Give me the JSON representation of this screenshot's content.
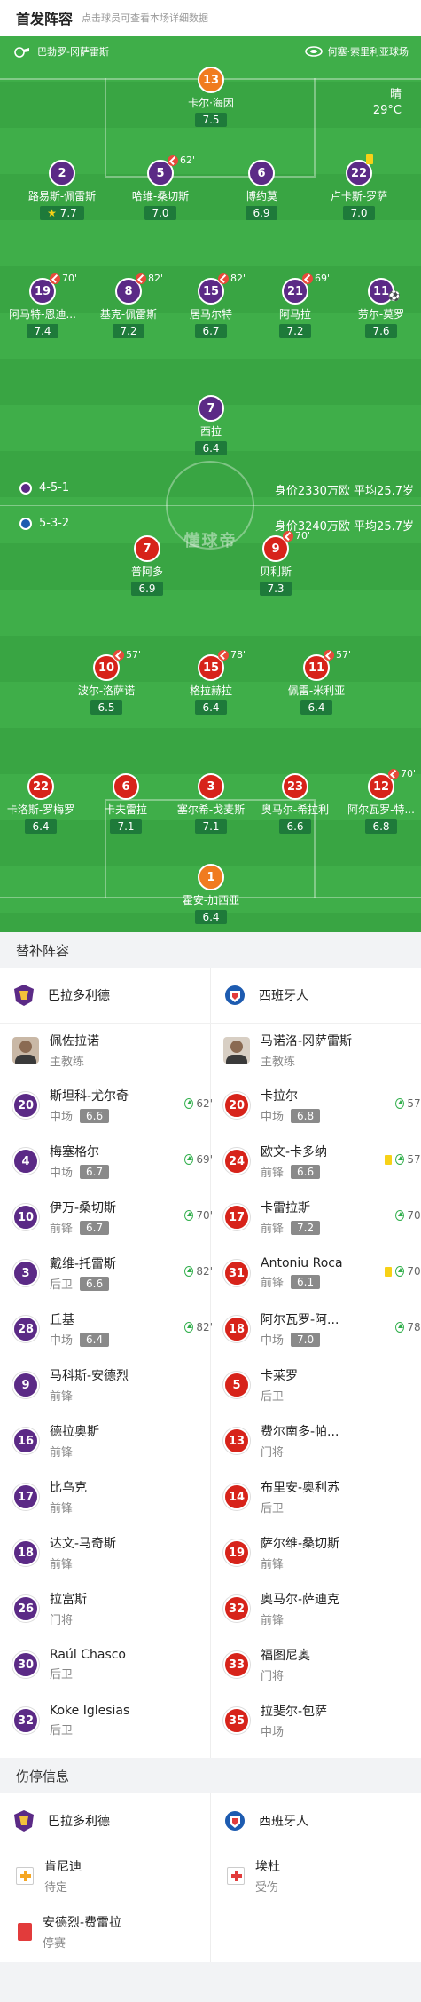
{
  "header": {
    "title": "首发阵容",
    "subtitle": "点击球员可查看本场详细数据"
  },
  "match": {
    "home_coach": "巴勃罗-冈萨雷斯",
    "venue": "何塞·索里利亚球场",
    "weather_label": "晴",
    "temperature": "29°C",
    "home_formation": "4-5-1",
    "away_formation": "5-3-2",
    "home_value": "身价2330万欧 平均25.7岁",
    "away_value": "身价3240万欧 平均25.7岁",
    "watermark": "懂球帝"
  },
  "colors": {
    "home": "#5b2a86",
    "away": "#d7231a",
    "gk": "#f07b1f",
    "pitch": "#3fae49"
  },
  "home_players": [
    {
      "num": "13",
      "name": "卡尔·海因",
      "rating": "7.5",
      "gk": true
    },
    {
      "num": "2",
      "name": "路易斯-佩雷斯",
      "rating": "7.7",
      "star": true
    },
    {
      "num": "5",
      "name": "哈维-桑切斯",
      "rating": "7.0",
      "event": "62'"
    },
    {
      "num": "6",
      "name": "博约莫",
      "rating": "6.9"
    },
    {
      "num": "22",
      "name": "卢卡斯-罗萨",
      "rating": "7.0",
      "card": "yellow"
    },
    {
      "num": "19",
      "name": "阿马特-恩迪...",
      "rating": "7.4",
      "event": "70'"
    },
    {
      "num": "8",
      "name": "基克-佩雷斯",
      "rating": "7.2",
      "event": "82'"
    },
    {
      "num": "15",
      "name": "居马尔特",
      "rating": "6.7",
      "event": "82'"
    },
    {
      "num": "21",
      "name": "阿马拉",
      "rating": "7.2",
      "event": "69'"
    },
    {
      "num": "11",
      "name": "劳尔-莫罗",
      "rating": "7.6",
      "ball": true
    },
    {
      "num": "7",
      "name": "西拉",
      "rating": "6.4"
    }
  ],
  "away_players": [
    {
      "num": "7",
      "name": "普阿多",
      "rating": "6.9"
    },
    {
      "num": "9",
      "name": "贝利斯",
      "rating": "7.3",
      "event": "70'"
    },
    {
      "num": "10",
      "name": "波尔-洛萨诺",
      "rating": "6.5",
      "event": "57'"
    },
    {
      "num": "15",
      "name": "格拉赫拉",
      "rating": "6.4",
      "event": "78'"
    },
    {
      "num": "11",
      "name": "佩雷-米利亚",
      "rating": "6.4",
      "event": "57'"
    },
    {
      "num": "22",
      "name": "卡洛斯-罗梅罗",
      "rating": "6.4"
    },
    {
      "num": "6",
      "name": "卡夫雷拉",
      "rating": "7.1"
    },
    {
      "num": "3",
      "name": "塞尔希-戈麦斯",
      "rating": "7.1"
    },
    {
      "num": "23",
      "name": "奥马尔-希拉利",
      "rating": "6.6"
    },
    {
      "num": "12",
      "name": "阿尔瓦罗-特...",
      "rating": "6.8",
      "event": "70'"
    },
    {
      "num": "1",
      "name": "霍安-加西亚",
      "rating": "6.4",
      "gk": true
    }
  ],
  "subs_section": "替补阵容",
  "home_team": "巴拉多利德",
  "away_team": "西班牙人",
  "home_coach": {
    "name": "佩佐拉诺",
    "role": "主教练"
  },
  "away_coach": {
    "name": "马诺洛-冈萨雷斯",
    "role": "主教练"
  },
  "home_subs": [
    {
      "num": "20",
      "name": "斯坦科-尤尔奇",
      "pos": "中场",
      "rating": "6.6",
      "time": "62'"
    },
    {
      "num": "4",
      "name": "梅塞格尔",
      "pos": "中场",
      "rating": "6.7",
      "time": "69'"
    },
    {
      "num": "10",
      "name": "伊万-桑切斯",
      "pos": "前锋",
      "rating": "6.7",
      "time": "70'"
    },
    {
      "num": "3",
      "name": "戴维-托雷斯",
      "pos": "后卫",
      "rating": "6.6",
      "time": "82'"
    },
    {
      "num": "28",
      "name": "丘基",
      "pos": "中场",
      "rating": "6.4",
      "time": "82'"
    },
    {
      "num": "9",
      "name": "马科斯-安德烈",
      "pos": "前锋"
    },
    {
      "num": "16",
      "name": "德拉奥斯",
      "pos": "前锋"
    },
    {
      "num": "17",
      "name": "比乌克",
      "pos": "前锋"
    },
    {
      "num": "18",
      "name": "达文-马奇斯",
      "pos": "前锋"
    },
    {
      "num": "26",
      "name": "拉富斯",
      "pos": "门将"
    },
    {
      "num": "30",
      "name": "Raúl Chasco",
      "pos": "后卫"
    },
    {
      "num": "32",
      "name": "Koke Iglesias",
      "pos": "后卫"
    }
  ],
  "away_subs": [
    {
      "num": "20",
      "name": "卡拉尔",
      "pos": "中场",
      "rating": "6.8",
      "time": "57'"
    },
    {
      "num": "24",
      "name": "欧文-卡多纳",
      "pos": "前锋",
      "rating": "6.6",
      "time": "57'",
      "card": "yellow"
    },
    {
      "num": "17",
      "name": "卡雷拉斯",
      "pos": "前锋",
      "rating": "7.2",
      "time": "70'"
    },
    {
      "num": "31",
      "name": "Antoniu Roca",
      "pos": "前锋",
      "rating": "6.1",
      "time": "70'",
      "card": "yellow"
    },
    {
      "num": "18",
      "name": "阿尔瓦罗-阿...",
      "pos": "中场",
      "rating": "7.0",
      "time": "78'"
    },
    {
      "num": "5",
      "name": "卡莱罗",
      "pos": "后卫"
    },
    {
      "num": "13",
      "name": "费尔南多-帕...",
      "pos": "门将"
    },
    {
      "num": "14",
      "name": "布里安-奥利苏",
      "pos": "后卫"
    },
    {
      "num": "19",
      "name": "萨尔维-桑切斯",
      "pos": "前锋"
    },
    {
      "num": "32",
      "name": "奥马尔-萨迪克",
      "pos": "前锋"
    },
    {
      "num": "33",
      "name": "福图尼奥",
      "pos": "门将"
    },
    {
      "num": "35",
      "name": "拉斐尔-包萨",
      "pos": "中场"
    }
  ],
  "injury_section": "伤停信息",
  "home_injuries": [
    {
      "name": "肯尼迪",
      "status": "待定",
      "type": "doubt"
    },
    {
      "name": "安德烈-费雷拉",
      "status": "停赛",
      "type": "suspended"
    }
  ],
  "away_injuries": [
    {
      "name": "埃杜",
      "status": "受伤",
      "type": "injured"
    }
  ]
}
